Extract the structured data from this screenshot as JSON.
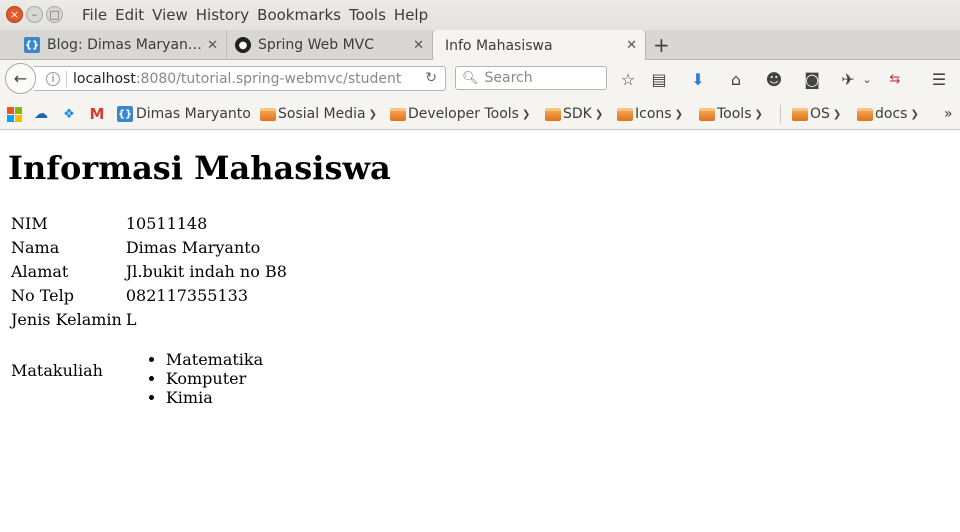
{
  "menubar": {
    "items": [
      "File",
      "Edit",
      "View",
      "History",
      "Bookmarks",
      "Tools",
      "Help"
    ]
  },
  "tabs": [
    {
      "title": "Blog: Dimas Maryan…",
      "icon": "brackets-icon"
    },
    {
      "title": "Spring Web MVC",
      "icon": "github-icon"
    },
    {
      "title": "Info Mahasiswa",
      "icon": "none",
      "active": true
    }
  ],
  "nav": {
    "url_host": "localhost",
    "url_rest": ":8080/tutorial.spring-webmvc/student",
    "search_placeholder": "Search"
  },
  "bookmarks": {
    "items": [
      {
        "label": "Dimas Maryanto",
        "type": "link"
      },
      {
        "label": "Sosial Media",
        "type": "folder"
      },
      {
        "label": "Developer Tools",
        "type": "folder"
      },
      {
        "label": "SDK",
        "type": "folder"
      },
      {
        "label": "Icons",
        "type": "folder"
      },
      {
        "label": "Tools",
        "type": "folder"
      },
      {
        "label": "OS",
        "type": "folder"
      },
      {
        "label": "docs",
        "type": "folder"
      }
    ],
    "overflow": "»"
  },
  "page": {
    "title": "Informasi Mahasiswa",
    "rows": [
      {
        "label": "NIM",
        "value": "10511148"
      },
      {
        "label": "Nama",
        "value": "Dimas Maryanto"
      },
      {
        "label": "Alamat",
        "value": "Jl.bukit indah no B8"
      },
      {
        "label": "No Telp",
        "value": "082117355133"
      },
      {
        "label": "Jenis Kelamin",
        "value": "L"
      }
    ],
    "matakuliah_label": "Matakuliah",
    "matakuliah": [
      "Matematika",
      "Komputer",
      "Kimia"
    ]
  },
  "colors": {
    "close_button": "#e4592a",
    "chrome_bg": "#f5f4f1",
    "download_arrow": "#2a7fd4"
  }
}
